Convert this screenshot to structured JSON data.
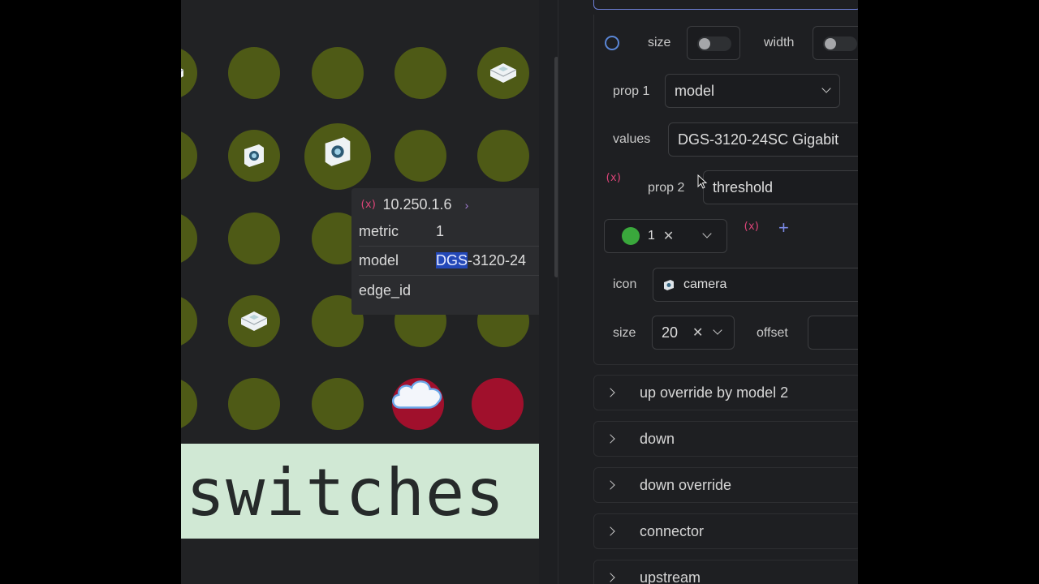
{
  "canvas": {
    "tooltip": {
      "ip": "10.250.1.6",
      "rows": [
        {
          "key": "metric",
          "value": "1",
          "highlight": "",
          "rest": ""
        },
        {
          "key": "model",
          "value": "",
          "highlight": "DGS",
          "rest": "-3120-24"
        },
        {
          "key": "edge_id",
          "value": "",
          "highlight": "",
          "rest": ""
        }
      ]
    },
    "banner_text": "switches",
    "colors": {
      "node_green": "#4e5a16",
      "node_red": "#a0102c",
      "banner": "#d0e8d4"
    }
  },
  "panel": {
    "size_label": "size",
    "width_label": "width",
    "prop1_label": "prop 1",
    "prop1_value": "model",
    "values_label": "values",
    "values_value": "DGS-3120-24SC Gigabit",
    "prop2_label": "prop 2",
    "prop2_value": "threshold",
    "threshold_chip": "1",
    "icon_label": "icon",
    "icon_value": "camera",
    "size2_label": "size",
    "size2_value": "20",
    "offset_label": "offset",
    "sections": [
      {
        "label": "up override by model 2"
      },
      {
        "label": "down"
      },
      {
        "label": "down override"
      },
      {
        "label": "connector"
      },
      {
        "label": "upstream"
      }
    ],
    "colors": {
      "accent": "#6d7fd6",
      "variable": "#e0457a",
      "threshold_green": "#3aa83c"
    }
  }
}
